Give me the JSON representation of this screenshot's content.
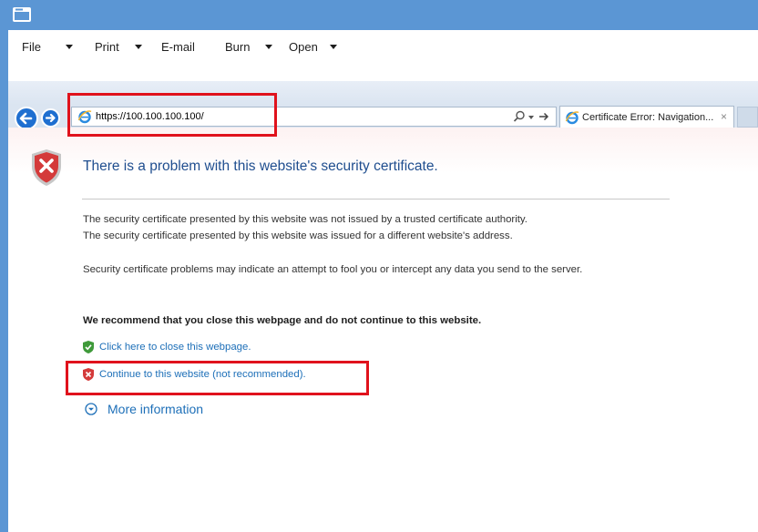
{
  "toolbar": {
    "file": "File",
    "print": "Print",
    "email": "E-mail",
    "burn": "Burn",
    "open": "Open"
  },
  "address_bar": {
    "url": "https://100.100.100.100/"
  },
  "tab": {
    "title": "Certificate Error: Navigation...",
    "close": "×"
  },
  "page": {
    "title": "There is a problem with this website's security certificate.",
    "para1_line1": "The security certificate presented by this website was not issued by a trusted certificate authority.",
    "para1_line2": "The security certificate presented by this website was issued for a different website's address.",
    "para2": "Security certificate problems may indicate an attempt to fool you or intercept any data you send to the server.",
    "recommend": "We recommend that you close this webpage and do not continue to this website.",
    "close_link": "Click here to close this webpage.",
    "continue_link": "Continue to this website (not recommended).",
    "more_info": "More information"
  },
  "colors": {
    "window_border": "#5b96d4",
    "title_text": "#1f4e8f",
    "link": "#1d6fb8",
    "highlight": "#e0121c",
    "shield_red": "#d43a3a",
    "shield_green": "#3f9a3a"
  }
}
